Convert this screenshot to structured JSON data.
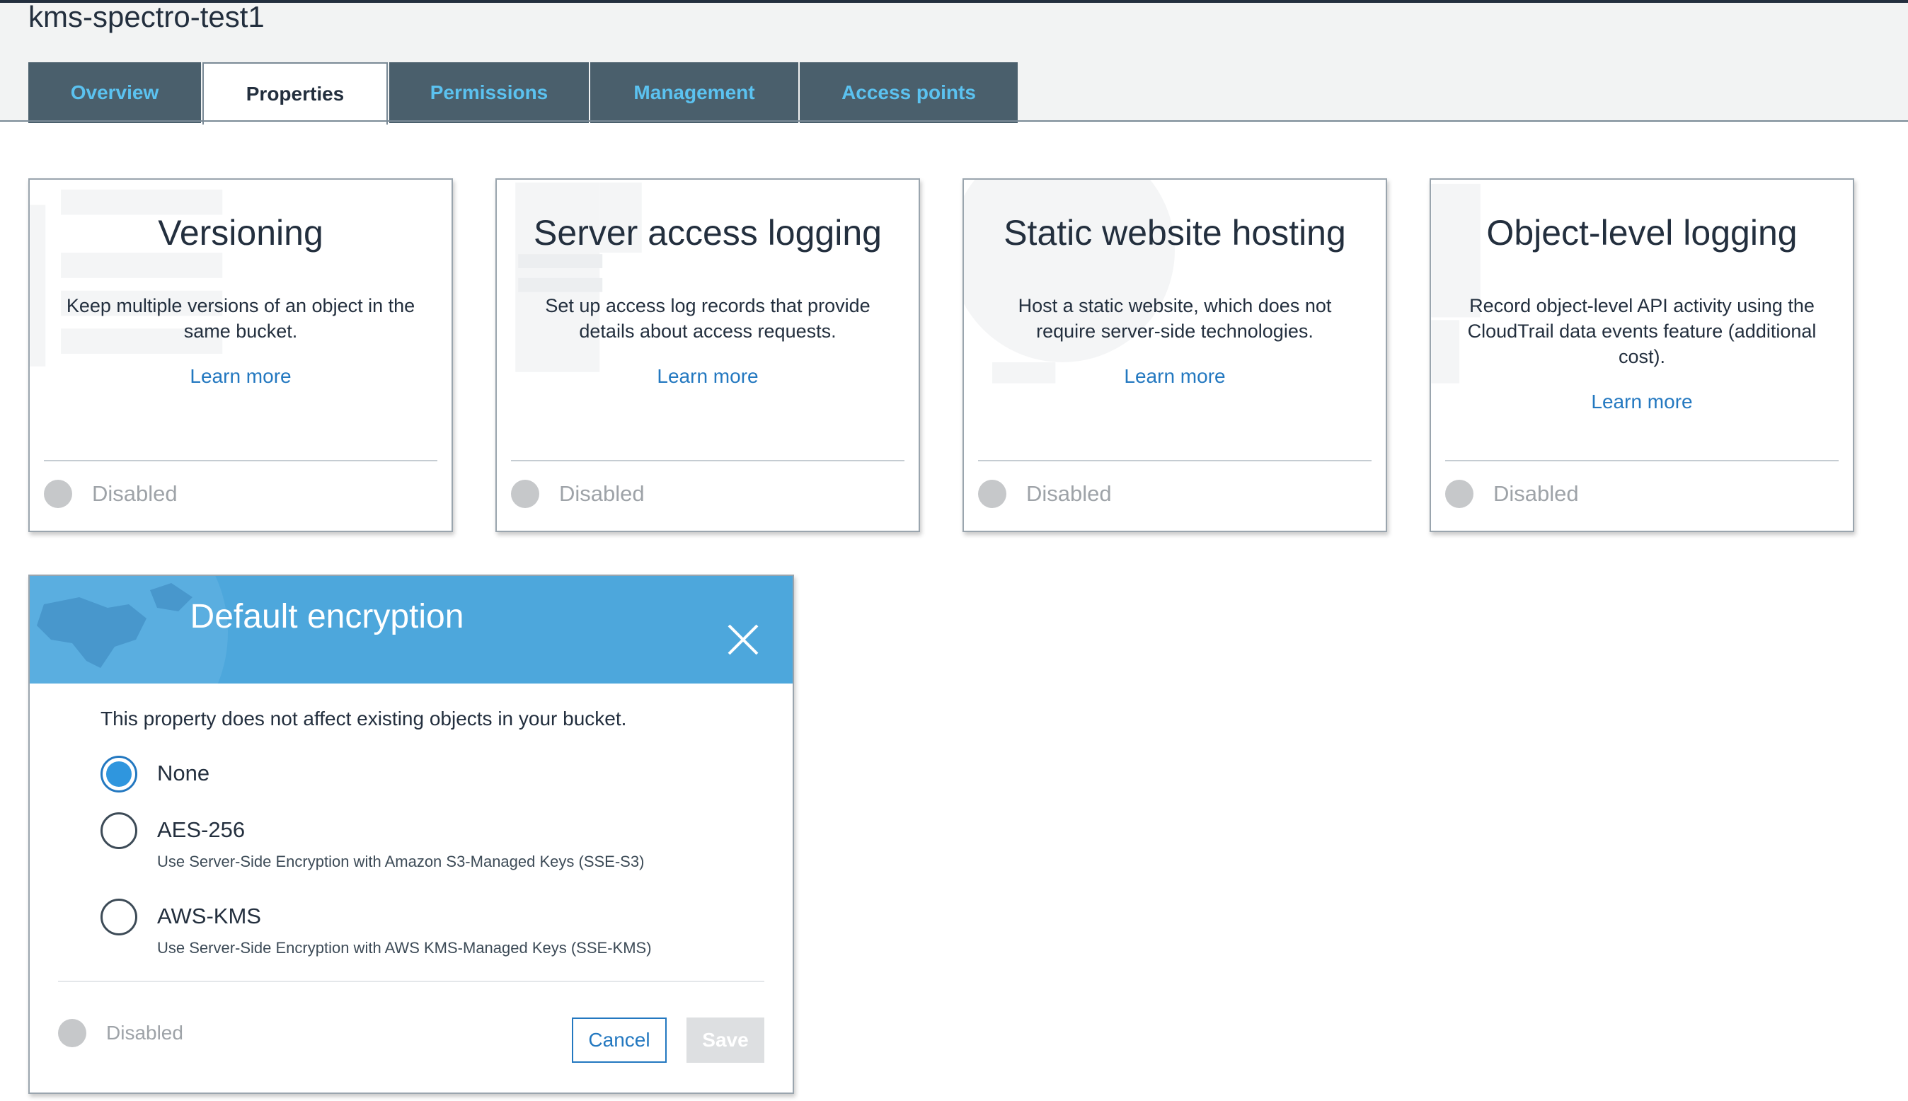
{
  "page": {
    "bucket_name": "kms-spectro-test1"
  },
  "tabs": [
    {
      "label": "Overview",
      "active": false
    },
    {
      "label": "Properties",
      "active": true
    },
    {
      "label": "Permissions",
      "active": false
    },
    {
      "label": "Management",
      "active": false
    },
    {
      "label": "Access points",
      "active": false
    }
  ],
  "cards": [
    {
      "title": "Versioning",
      "description": "Keep multiple versions of an object in the same bucket.",
      "link": "Learn more",
      "status": "Disabled"
    },
    {
      "title": "Server access logging",
      "description": "Set up access log records that provide details about access requests.",
      "link": "Learn more",
      "status": "Disabled"
    },
    {
      "title": "Static website hosting",
      "description": "Host a static website, which does not require server-side technologies.",
      "link": "Learn more",
      "status": "Disabled"
    },
    {
      "title": "Object-level logging",
      "description": "Record object-level API activity using the CloudTrail data events feature (additional cost).",
      "link": "Learn more",
      "status": "Disabled"
    }
  ],
  "encryption": {
    "title": "Default encryption",
    "note": "This property does not affect existing objects in your bucket.",
    "options": [
      {
        "label": "None",
        "sub": "",
        "selected": true
      },
      {
        "label": "AES-256",
        "sub": "Use Server-Side Encryption with Amazon S3-Managed Keys (SSE-S3)",
        "selected": false
      },
      {
        "label": "AWS-KMS",
        "sub": "Use Server-Side Encryption with AWS KMS-Managed Keys (SSE-KMS)",
        "selected": false
      }
    ],
    "status": "Disabled",
    "cancel_label": "Cancel",
    "save_label": "Save"
  },
  "colors": {
    "tab_bg": "#4a5f6c",
    "tab_text": "#5bc2f0",
    "link": "#2378c0",
    "encryption_header": "#4da7dc",
    "radio_selected": "#2f96de"
  },
  "icons": {
    "close": "close-icon",
    "status": "status-dot-icon"
  }
}
